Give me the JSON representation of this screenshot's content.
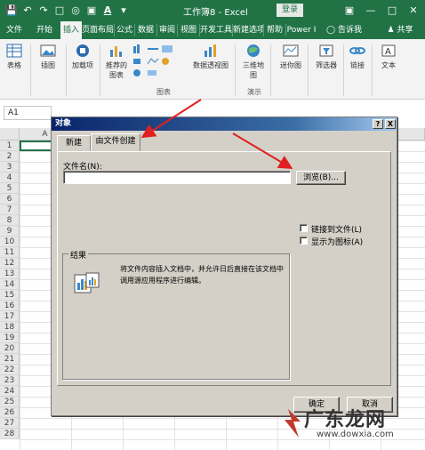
{
  "title_bar": {
    "doc_title": "工作簿8 - Excel",
    "login": "登录",
    "qat_icons": [
      "save-icon",
      "undo-icon",
      "redo-icon",
      "new-doc-icon",
      "camera-icon",
      "screen-icon",
      "font-color-icon",
      "dropdown-icon"
    ],
    "window_controls": [
      "ribbon-display-icon",
      "minimize-icon",
      "restore-icon",
      "close-icon"
    ]
  },
  "ribbon_tabs": [
    "文件",
    "开始",
    "插入",
    "页面布局",
    "公式",
    "数据",
    "审阅",
    "视图",
    "开发工具",
    "新建选项卡",
    "帮助",
    "Power I",
    "告诉我",
    "共享"
  ],
  "active_tab": "插入",
  "ribbon": {
    "items": [
      {
        "label": "表格",
        "icon": "table-icon"
      },
      {
        "label": "插图",
        "icon": "illustration-icon"
      },
      {
        "label": "加载项",
        "icon": "addin-icon"
      },
      {
        "label": "推荐的图表",
        "icon": "recommended-chart-icon"
      },
      {
        "label": "数据透视图",
        "icon": "pivot-chart-icon"
      },
      {
        "label": "三维地图",
        "icon": "3d-map-icon"
      },
      {
        "label": "迷你图",
        "icon": "sparkline-icon"
      },
      {
        "label": "筛选器",
        "icon": "filter-icon"
      },
      {
        "label": "链接",
        "icon": "link-icon"
      },
      {
        "label": "文本",
        "icon": "text-icon"
      }
    ],
    "group_labels": [
      "图表",
      "演示"
    ]
  },
  "formula_bar": {
    "name_box": "A1"
  },
  "sheet": {
    "columns": [
      "A"
    ],
    "rows": [
      "1",
      "2",
      "3",
      "4",
      "5",
      "6",
      "7",
      "8",
      "9",
      "10",
      "11",
      "12",
      "13",
      "14",
      "15",
      "16",
      "17",
      "18",
      "19",
      "20",
      "21",
      "22",
      "23",
      "24",
      "25",
      "26",
      "27",
      "28"
    ]
  },
  "dialog": {
    "title": "对象",
    "help_label": "?",
    "close_label": "X",
    "tabs": [
      "新建",
      "由文件创建"
    ],
    "active_tab": "由文件创建",
    "filename_label": "文件名(N):",
    "filename_value": "",
    "browse_label": "浏览(B)...",
    "link_label": "链接到文件(L)",
    "link_checked": false,
    "icon_label": "显示为图标(A)",
    "icon_checked": false,
    "result_label": "结果",
    "result_text": "将文件内容插入文档中，并允许日后直接在该文档中调用源应用程序进行编辑。",
    "ok_label": "确定",
    "cancel_label": "取消"
  },
  "annotation_color": "#e02020",
  "watermark": {
    "big": "广东龙网",
    "small": "www.dowxia.com"
  }
}
